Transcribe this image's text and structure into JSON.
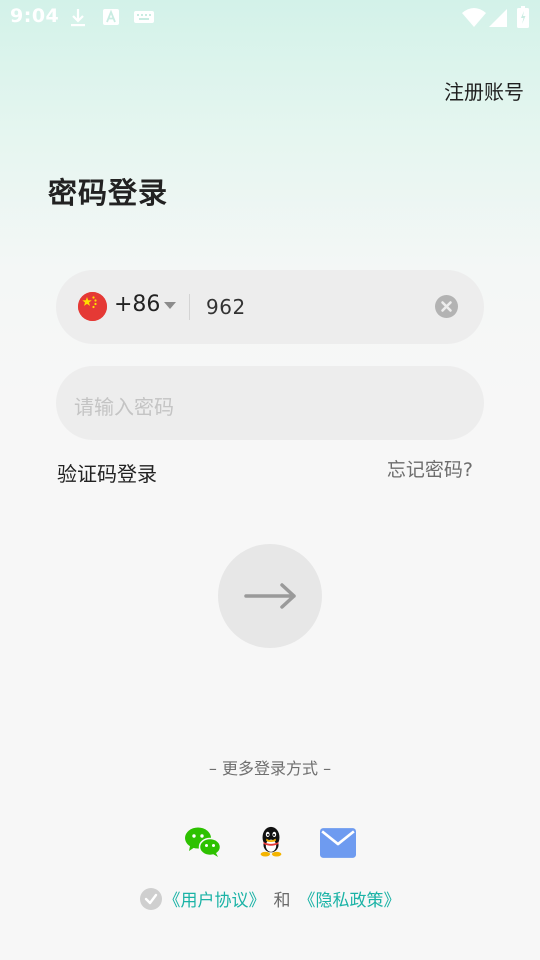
{
  "status_bar": {
    "time": "9:04",
    "left_icons": [
      "download-icon",
      "a-notification-icon",
      "keyboard-icon"
    ],
    "right_icons": [
      "wifi-icon",
      "signal-icon",
      "battery-icon"
    ]
  },
  "header": {
    "register_label": "注册账号"
  },
  "title": "密码登录",
  "phone": {
    "country_flag": "china-flag-icon",
    "country_code": "+86",
    "value": "962"
  },
  "password": {
    "placeholder": "请输入密码"
  },
  "links": {
    "sms_login": "验证码登录",
    "forgot_password": "忘记密码?"
  },
  "submit": {
    "icon": "arrow-right-icon"
  },
  "more_login": {
    "label": "– 更多登录方式 –",
    "options": [
      "wechat-icon",
      "qq-icon",
      "email-icon"
    ]
  },
  "agreement": {
    "user_agreement": "《用户协议》",
    "and": "和",
    "privacy_policy": "《隐私政策》"
  },
  "colors": {
    "accent": "#1bb3a6",
    "wechat": "#2dc100",
    "email": "#6e9bf0"
  }
}
